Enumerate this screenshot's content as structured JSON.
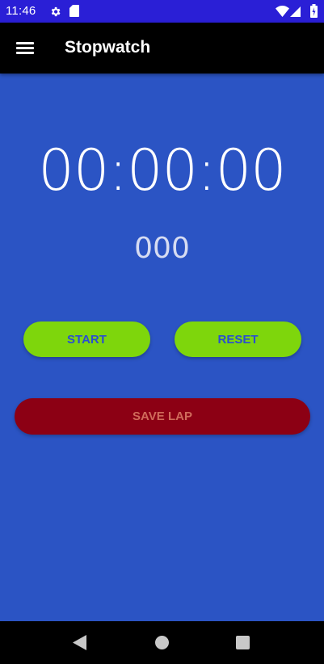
{
  "status_bar": {
    "time": "11:46",
    "icons": [
      "gear-icon",
      "sd-card-icon",
      "wifi-icon",
      "signal-icon",
      "battery-icon"
    ],
    "background": "#2a1fd6"
  },
  "app_bar": {
    "title": "Stopwatch",
    "menu_icon": "menu-icon",
    "background": "#000000"
  },
  "stopwatch": {
    "time": "00:00:00",
    "milliseconds": "000",
    "background": "#2b54c4"
  },
  "buttons": {
    "start_label": "START",
    "reset_label": "RESET",
    "save_lap_label": "SAVE LAP",
    "primary_color": "#7ed60c",
    "danger_color": "#8c0014"
  },
  "nav_bar": {
    "icons": [
      "back-icon",
      "home-icon",
      "recent-apps-icon"
    ]
  }
}
